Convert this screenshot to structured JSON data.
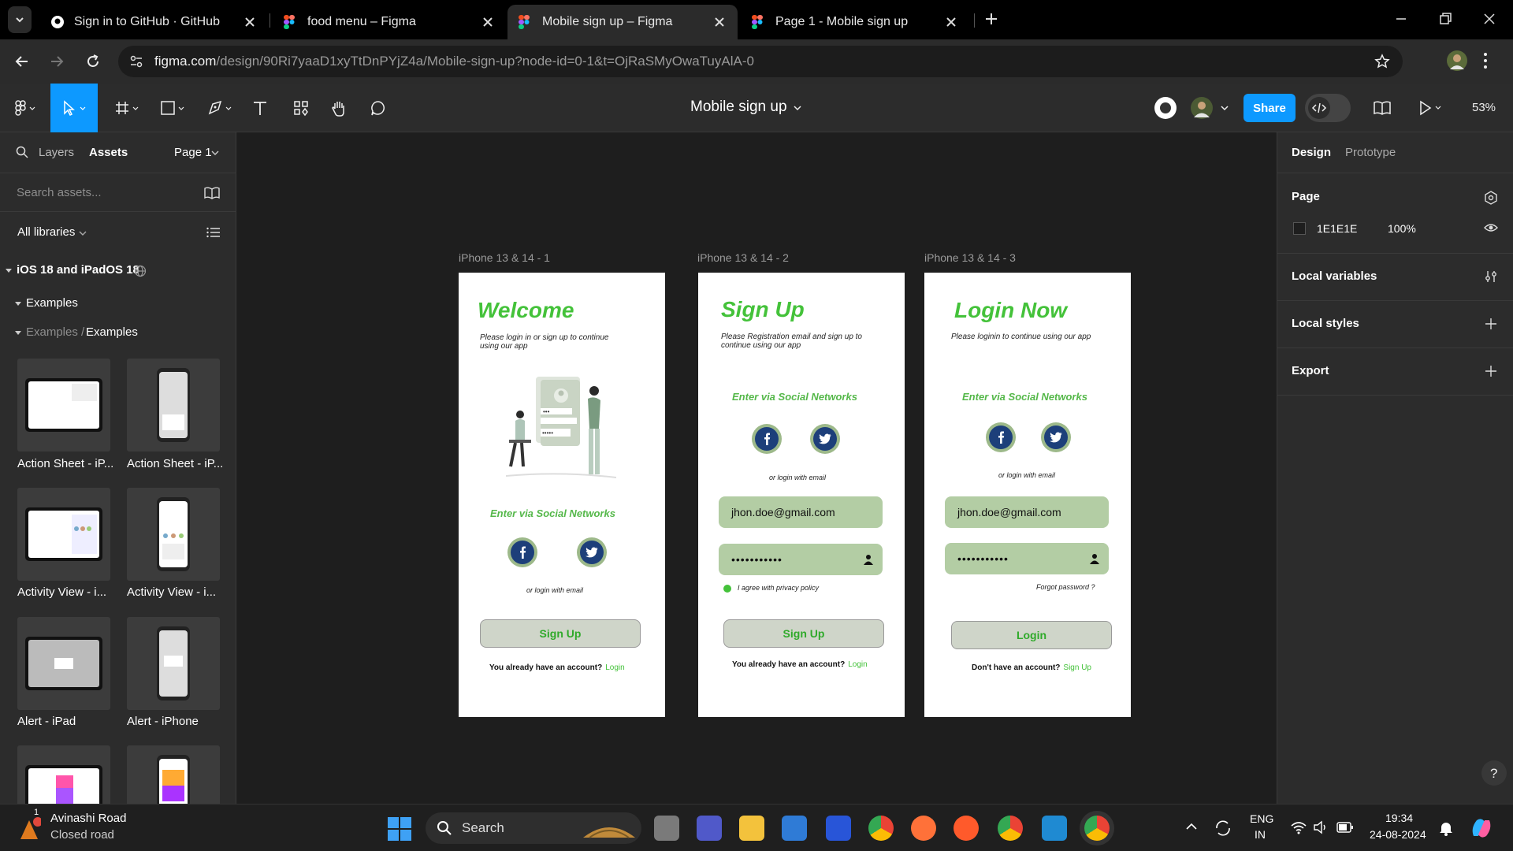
{
  "browser": {
    "tabs": [
      {
        "title": "Sign in to GitHub · GitHub"
      },
      {
        "title": "food menu – Figma"
      },
      {
        "title": "Mobile sign up – Figma"
      },
      {
        "title": "Page 1 - Mobile sign up"
      }
    ],
    "url_host": "figma.com",
    "url_path": "/design/90Ri7yaaD1xyTtDnPYjZ4a/Mobile-sign-up?node-id=0-1&t=OjRaSMyOwaTuyAlA-0"
  },
  "figma": {
    "file_title": "Mobile sign up",
    "share_label": "Share",
    "zoom": "53%"
  },
  "left_panel": {
    "tab_layers": "Layers",
    "tab_assets": "Assets",
    "page_select": "Page 1",
    "search_placeholder": "Search assets...",
    "all_libraries": "All libraries",
    "library_name": "iOS 18 and iPadOS 18",
    "section_examples": "Examples",
    "breadcrumb_parent": "Examples /",
    "breadcrumb_current": "Examples",
    "components": [
      {
        "label": "Action Sheet - iP..."
      },
      {
        "label": "Action Sheet - iP..."
      },
      {
        "label": "Activity View - i..."
      },
      {
        "label": "Activity View - i..."
      },
      {
        "label": "Alert - iPad"
      },
      {
        "label": "Alert - iPhone"
      }
    ]
  },
  "canvas": {
    "frames": [
      {
        "label": "iPhone 13 & 14 - 1",
        "title": "Welcome",
        "subtitle": "Please login in or sign up to continue using our app",
        "social": "Enter via Social Networks",
        "or_email": "or login with email",
        "button": "Sign Up",
        "bottom_text": "You already have an account?",
        "bottom_link": "Login"
      },
      {
        "label": "iPhone 13 & 14 - 2",
        "title": "Sign Up",
        "subtitle": "Please Registration email and sign up to continue using our app",
        "social": "Enter via Social Networks",
        "or_email": "or login with email",
        "email": "jhon.doe@gmail.com",
        "password": "•••••••••••",
        "agree": "I agree with privacy policy",
        "button": "Sign Up",
        "bottom_text": "You already have an account?",
        "bottom_link": "Login"
      },
      {
        "label": "iPhone 13 & 14 - 3",
        "title": "Login Now",
        "subtitle": "Please loginin to continue using our app",
        "social": "Enter via Social Networks",
        "or_email": "or login with email",
        "email": "jhon.doe@gmail.com",
        "password": "•••••••••••",
        "forgot": "Forgot password ?",
        "button": "Login",
        "bottom_text": "Don't have an account?",
        "bottom_link": "Sign Up"
      }
    ]
  },
  "right_panel": {
    "tab_design": "Design",
    "tab_prototype": "Prototype",
    "page_heading": "Page",
    "page_color": "1E1E1E",
    "page_opacity": "100%",
    "local_variables": "Local variables",
    "local_styles": "Local styles",
    "export": "Export"
  },
  "taskbar": {
    "weather_title": "Avinashi Road",
    "weather_sub": "Closed road",
    "weather_badge": "1",
    "search_label": "Search",
    "lang_1": "ENG",
    "lang_2": "IN",
    "time": "19:34",
    "date": "24-08-2024"
  },
  "colors": {
    "accent": "#0d99ff",
    "brand_green": "#44c23a",
    "input_green": "#b3cda4",
    "facebook_blue": "#1d3f7a"
  }
}
